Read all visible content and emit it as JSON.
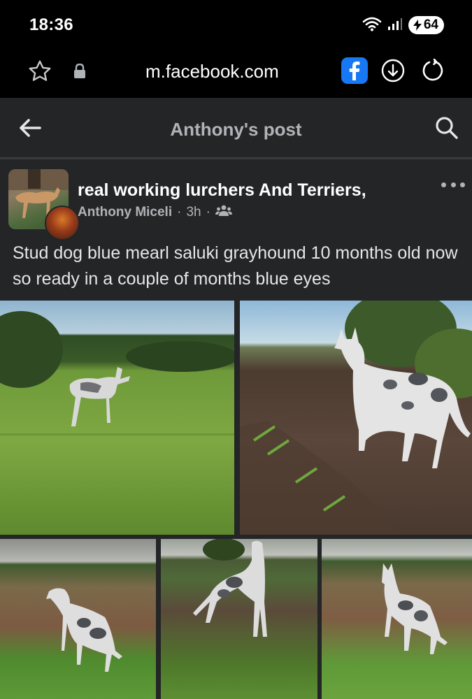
{
  "status_bar": {
    "time": "18:36",
    "battery": "64",
    "icons": [
      "wifi-icon",
      "signal-icon",
      "battery-icon"
    ]
  },
  "browser": {
    "url": "m.facebook.com",
    "icons": [
      "star-icon",
      "lock-icon",
      "facebook-icon",
      "download-icon",
      "reload-icon"
    ],
    "facebook_color": "#1877f2"
  },
  "page_header": {
    "title": "Anthony's post",
    "icons": [
      "back-arrow-icon",
      "search-icon"
    ]
  },
  "post": {
    "group_name": "real working lurchers And Terriers,",
    "author": "Anthony Miceli",
    "time_ago": "3h",
    "separator": "·",
    "audience_icon": "group-audience-icon",
    "text": "Stud dog blue mearl saluki grayhound 10 months old now so ready in a couple of months blue eyes",
    "photos": [
      {
        "description_icon": "photo"
      },
      {
        "description_icon": "photo"
      },
      {
        "description_icon": "photo"
      },
      {
        "description_icon": "photo"
      },
      {
        "description_icon": "photo"
      }
    ]
  }
}
